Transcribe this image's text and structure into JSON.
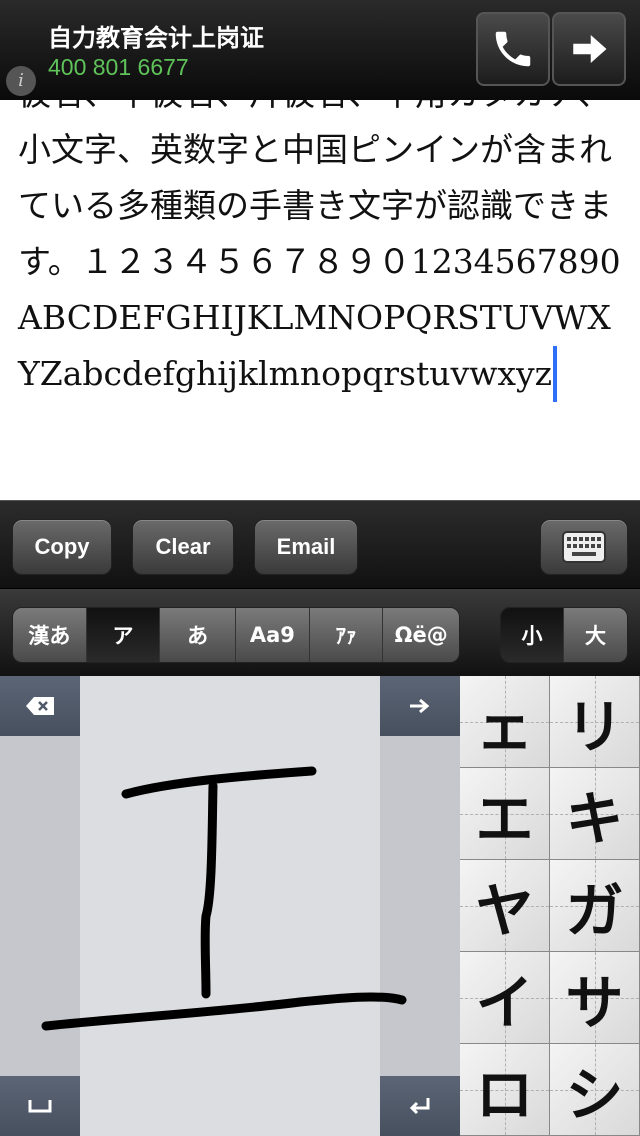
{
  "ad": {
    "title": "自力教育会计上岗证",
    "phone": "400 801 6677",
    "info_icon": "info-icon",
    "call_icon": "phone-icon",
    "go_icon": "arrow-right-icon"
  },
  "text_area": {
    "content": "仮名、平仮名、片仮名、半角カタカナ、小文字、英数字と中国ピンインが含まれている多種類の手書き文字が認識できます。１２３４５６７８９０1234567890ABCDEFGHIJKLMNOPQRSTUVWXYZabcdefghijklmnopqrstuvwxyz"
  },
  "actions": {
    "copy": "Copy",
    "clear": "Clear",
    "email": "Email",
    "keyboard_icon": "keyboard-icon"
  },
  "modes": {
    "items": [
      "漢あ",
      "ア",
      "あ",
      "Aa9",
      "ｱｧ",
      "Ωë@"
    ],
    "selected": "ア",
    "size_items": [
      "小",
      "大"
    ],
    "size_selected": "小"
  },
  "pad": {
    "backspace_icon": "backspace-icon",
    "next_icon": "arrow-right-icon",
    "space_icon": "space-icon",
    "return_icon": "return-icon"
  },
  "candidates": [
    "ェ",
    "リ",
    "エ",
    "キ",
    "ヤ",
    "ガ",
    "イ",
    "サ",
    "ロ",
    "シ"
  ],
  "colors": {
    "accent_green": "#5fc35a",
    "caret_blue": "#2d6ff7",
    "pad_key": "#4f5868"
  }
}
